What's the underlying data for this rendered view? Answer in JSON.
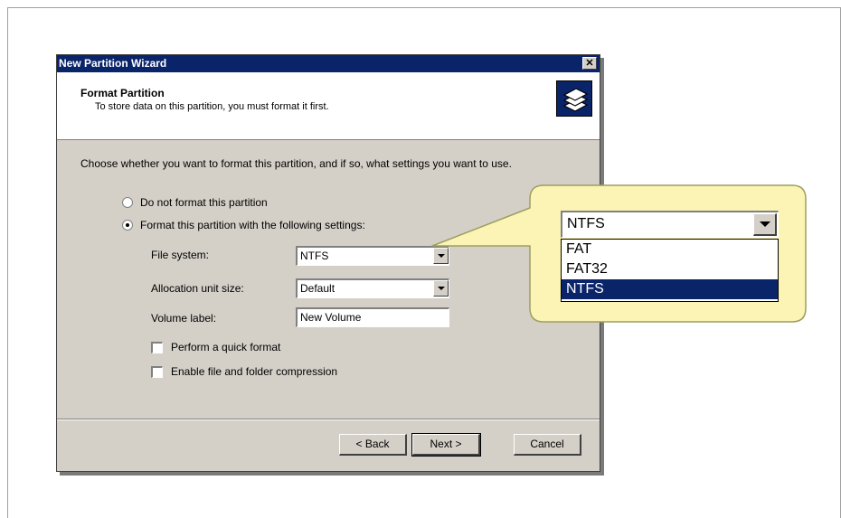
{
  "dialog": {
    "title": "New Partition Wizard",
    "close_glyph": "✕",
    "header_title": "Format Partition",
    "header_subtitle": "To store data on this partition, you must format it first.",
    "header_icon": "partition-disk-icon",
    "instruction": "Choose whether you want to format this partition, and if so, what settings you want to use.",
    "radio_no_format": "Do not format this partition",
    "radio_format": "Format this partition with the following settings:",
    "radio_selected": "format",
    "file_system_label": "File system:",
    "file_system_value": "NTFS",
    "allocation_label": "Allocation unit size:",
    "allocation_value": "Default",
    "volume_label_label": "Volume label:",
    "volume_label_value": "New Volume",
    "quick_format_label": "Perform a quick format",
    "quick_format_checked": false,
    "compression_label": "Enable file and folder compression",
    "compression_checked": false,
    "back_label": "< Back",
    "next_label": "Next >",
    "cancel_label": "Cancel"
  },
  "callout": {
    "combo_value": "NTFS",
    "options": [
      "FAT",
      "FAT32",
      "NTFS"
    ],
    "selected_option": "NTFS",
    "fill_color": "#fbf4b4",
    "border_color": "#9e9e60"
  },
  "colors": {
    "titlebar": "#0a246a",
    "dialog_bg": "#d4d0c8",
    "selection": "#0a246a"
  }
}
